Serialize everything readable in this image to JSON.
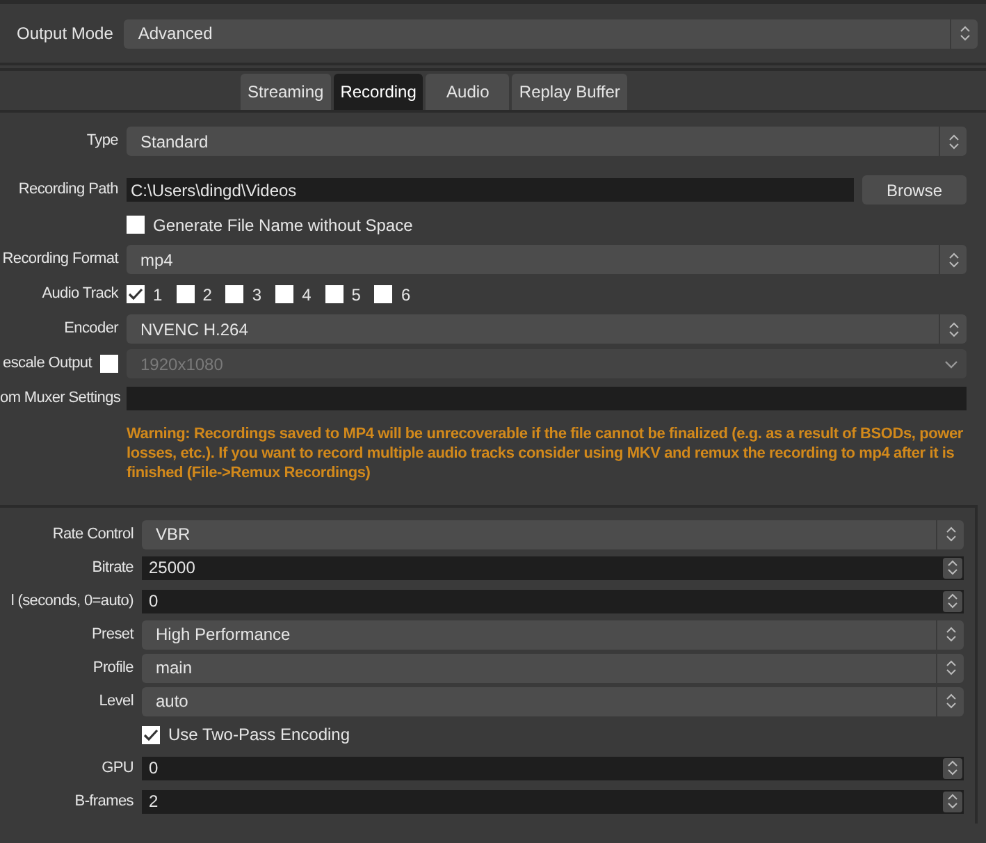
{
  "output_mode": {
    "label": "Output Mode",
    "value": "Advanced"
  },
  "tabs": [
    {
      "label": "Streaming",
      "selected": false
    },
    {
      "label": "Recording",
      "selected": true
    },
    {
      "label": "Audio",
      "selected": false
    },
    {
      "label": "Replay Buffer",
      "selected": false
    }
  ],
  "recording": {
    "rows": [
      {
        "kind": "combo",
        "label": "Type",
        "value": "Standard"
      },
      {
        "kind": "path",
        "label": "Recording Path",
        "value": "C:\\Users\\dingd\\Videos",
        "button": "Browse"
      },
      {
        "kind": "checkbox",
        "label": "Generate File Name without Space",
        "checked": false
      },
      {
        "kind": "combo",
        "label": "Recording Format",
        "value": "mp4"
      },
      {
        "kind": "tracks",
        "label": "Audio Track",
        "tracks": [
          {
            "label": "1",
            "checked": true
          },
          {
            "label": "2",
            "checked": false
          },
          {
            "label": "3",
            "checked": false
          },
          {
            "label": "4",
            "checked": false
          },
          {
            "label": "5",
            "checked": false
          },
          {
            "label": "6",
            "checked": false
          }
        ]
      },
      {
        "kind": "combo",
        "label": "Encoder",
        "value": "NVENC H.264"
      },
      {
        "kind": "rescale",
        "label": "escale Output",
        "checked": false,
        "value": "1920x1080",
        "disabled": true
      },
      {
        "kind": "text",
        "label": "om Muxer Settings"
      }
    ],
    "warning": "Warning: Recordings saved to MP4 will be unrecoverable if the file cannot be finalized (e.g. as a result of BSODs, power losses, etc.). If you want to record multiple audio tracks consider using MKV and remux the recording to mp4 after it is finished (File->Remux Recordings)"
  },
  "encoder_settings": {
    "rows": [
      {
        "kind": "combo",
        "label": "Rate Control",
        "value": "VBR"
      },
      {
        "kind": "spin",
        "label": "Bitrate",
        "value": "25000"
      },
      {
        "kind": "spin",
        "label": "l (seconds, 0=auto)",
        "value": "0"
      },
      {
        "kind": "combo",
        "label": "Preset",
        "value": "High Performance"
      },
      {
        "kind": "combo",
        "label": "Profile",
        "value": "main"
      },
      {
        "kind": "combo",
        "label": "Level",
        "value": "auto"
      },
      {
        "kind": "checkbox",
        "label": "Use Two-Pass Encoding",
        "checked": true
      },
      {
        "kind": "spin",
        "label": "GPU",
        "value": "0"
      },
      {
        "kind": "spin",
        "label": "B-frames",
        "value": "2"
      }
    ]
  }
}
